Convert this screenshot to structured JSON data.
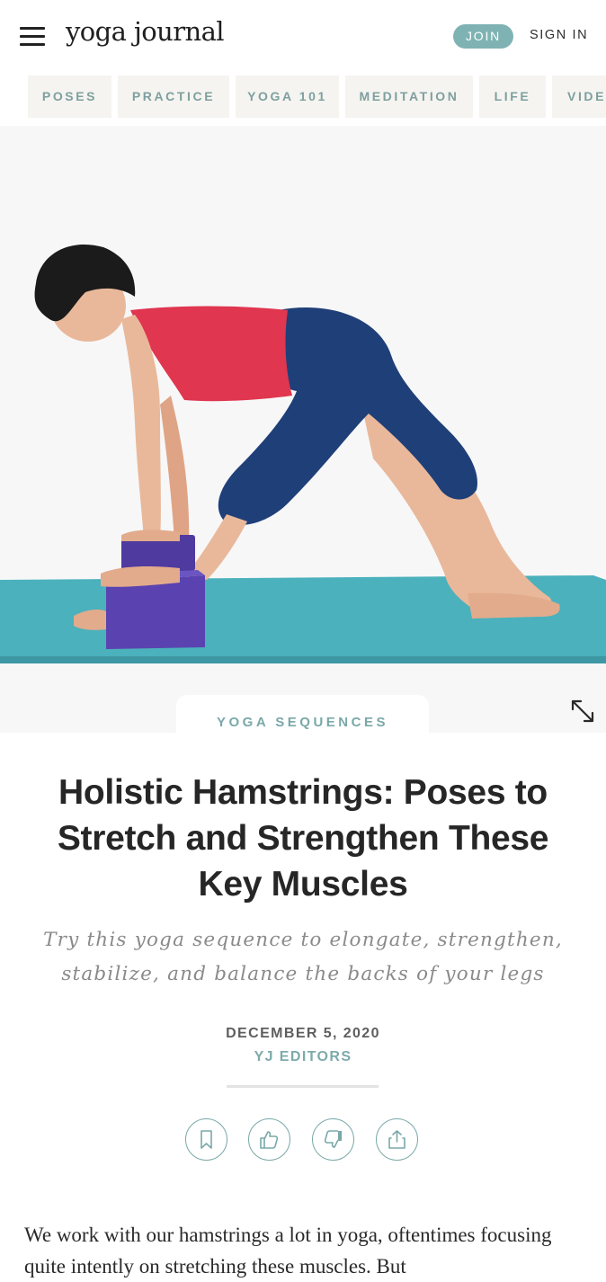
{
  "header": {
    "logo": "yoga journal",
    "join_label": "JOIN",
    "signin_label": "SIGN IN"
  },
  "nav": {
    "tabs": [
      {
        "label": "POSES"
      },
      {
        "label": "PRACTICE"
      },
      {
        "label": "YOGA 101"
      },
      {
        "label": "MEDITATION"
      },
      {
        "label": "LIFE"
      },
      {
        "label": "VIDEO"
      }
    ]
  },
  "article": {
    "category": "YOGA SEQUENCES",
    "title": "Holistic Hamstrings: Poses to Stretch and Strengthen These Key Muscles",
    "subtitle": "Try this yoga sequence to elongate, strengthen, stabilize, and balance the backs of your legs",
    "date": "DECEMBER 5, 2020",
    "author": "YJ EDITORS",
    "body": "We work with our hamstrings a lot in yoga, oftentimes focusing quite intently on stretching these muscles. But"
  },
  "icons": {
    "menu": "hamburger-icon",
    "expand": "expand-icon",
    "actions": [
      "bookmark-icon",
      "thumbs-up-icon",
      "thumbs-down-icon",
      "share-icon"
    ]
  },
  "colors": {
    "accent": "#7fb3b3",
    "mat": "#4bb1bc",
    "tank": "#e0364f",
    "leggings": "#1f3f78",
    "blocks": "#5a43b0"
  }
}
